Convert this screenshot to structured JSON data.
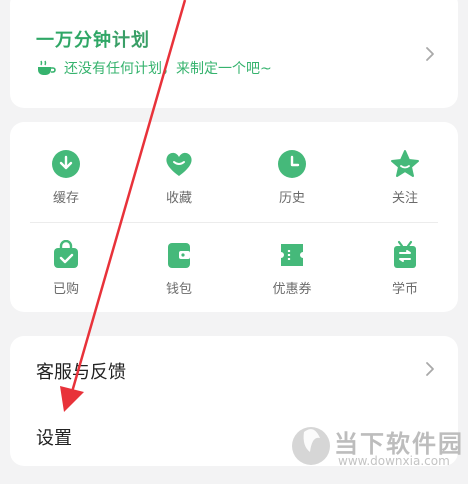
{
  "plan": {
    "title_a": "一万分钟",
    "title_b": "计划",
    "subtitle": "还没有任何计划，来制定一个吧~"
  },
  "grid": {
    "items": [
      {
        "label": "缓存",
        "icon": "download-cloud-icon"
      },
      {
        "label": "收藏",
        "icon": "heart-icon"
      },
      {
        "label": "历史",
        "icon": "clock-icon"
      },
      {
        "label": "关注",
        "icon": "star-icon"
      },
      {
        "label": "已购",
        "icon": "purchased-bag-icon"
      },
      {
        "label": "钱包",
        "icon": "wallet-icon"
      },
      {
        "label": "优惠券",
        "icon": "coupon-icon"
      },
      {
        "label": "学币",
        "icon": "coin-gift-icon"
      }
    ]
  },
  "list": {
    "feedback": "客服与反馈",
    "settings": "设置"
  },
  "watermark": {
    "text": "当下软件园",
    "url": "www.downxia.com"
  },
  "colors": {
    "accent": "#36b36e",
    "arrow": "#e8323a",
    "background": "#f3f3f4"
  }
}
